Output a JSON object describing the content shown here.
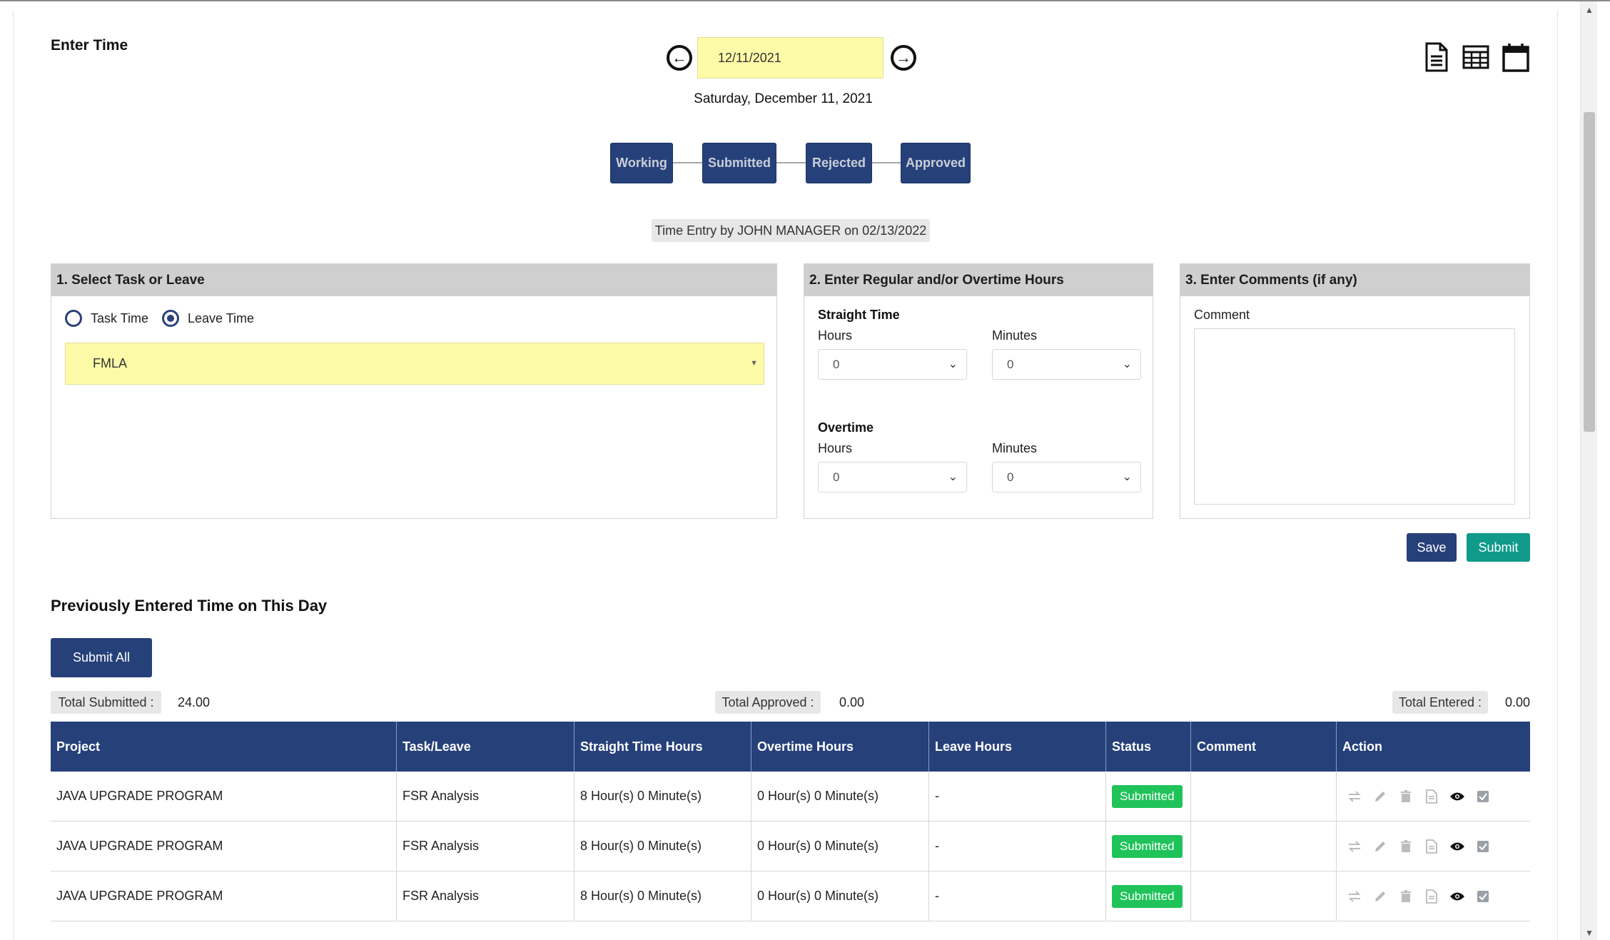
{
  "page_title": "Enter Time",
  "date_nav": {
    "date_value": "12/11/2021",
    "date_long": "Saturday, December 11, 2021",
    "prev_icon": "arrow-left-circle",
    "next_icon": "arrow-right-circle"
  },
  "view_icons": [
    "document-icon",
    "grid-icon",
    "calendar-icon"
  ],
  "status_steps": [
    "Working",
    "Submitted",
    "Rejected",
    "Approved"
  ],
  "entry_info": "Time Entry by JOHN MANAGER on 02/13/2022",
  "task_panel": {
    "heading": "1. Select Task or Leave",
    "task_time_label": "Task Time",
    "leave_time_label": "Leave Time",
    "selected_mode": "Leave Time",
    "leave_value": "FMLA"
  },
  "hours_panel": {
    "heading": "2. Enter Regular and/or Overtime Hours",
    "straight_label": "Straight Time",
    "overtime_label": "Overtime",
    "hours_label": "Hours",
    "minutes_label": "Minutes",
    "straight_hours": "0",
    "straight_minutes": "0",
    "overtime_hours": "0",
    "overtime_minutes": "0"
  },
  "comments_panel": {
    "heading": "3. Enter Comments (if any)",
    "comment_label": "Comment",
    "comment_value": ""
  },
  "buttons": {
    "save": "Save",
    "submit": "Submit",
    "submit_all": "Submit All"
  },
  "previous_section_title": "Previously Entered Time on This Day",
  "totals": {
    "submitted_label": "Total Submitted :",
    "submitted_value": "24.00",
    "approved_label": "Total Approved :",
    "approved_value": "0.00",
    "entered_label": "Total Entered :",
    "entered_value": "0.00"
  },
  "table": {
    "headers": [
      "Project",
      "Task/Leave",
      "Straight Time Hours",
      "Overtime Hours",
      "Leave Hours",
      "Status",
      "Comment",
      "Action"
    ],
    "rows": [
      {
        "project": "JAVA UPGRADE PROGRAM",
        "task": "FSR Analysis",
        "straight": "8 Hour(s) 0 Minute(s)",
        "overtime": "0 Hour(s) 0 Minute(s)",
        "leave": "-",
        "status": "Submitted",
        "comment": ""
      },
      {
        "project": "JAVA UPGRADE PROGRAM",
        "task": "FSR Analysis",
        "straight": "8 Hour(s) 0 Minute(s)",
        "overtime": "0 Hour(s) 0 Minute(s)",
        "leave": "-",
        "status": "Submitted",
        "comment": ""
      },
      {
        "project": "JAVA UPGRADE PROGRAM",
        "task": "FSR Analysis",
        "straight": "8 Hour(s) 0 Minute(s)",
        "overtime": "0 Hour(s) 0 Minute(s)",
        "leave": "-",
        "status": "Submitted",
        "comment": ""
      }
    ],
    "action_icons": [
      "transfer-icon",
      "edit-icon",
      "delete-icon",
      "document-icon",
      "view-icon",
      "approve-checkbox-icon"
    ]
  },
  "colors": {
    "primary": "#26407a",
    "teal": "#0f9a8a",
    "success": "#1fc35a",
    "highlight": "#fdfba8"
  }
}
